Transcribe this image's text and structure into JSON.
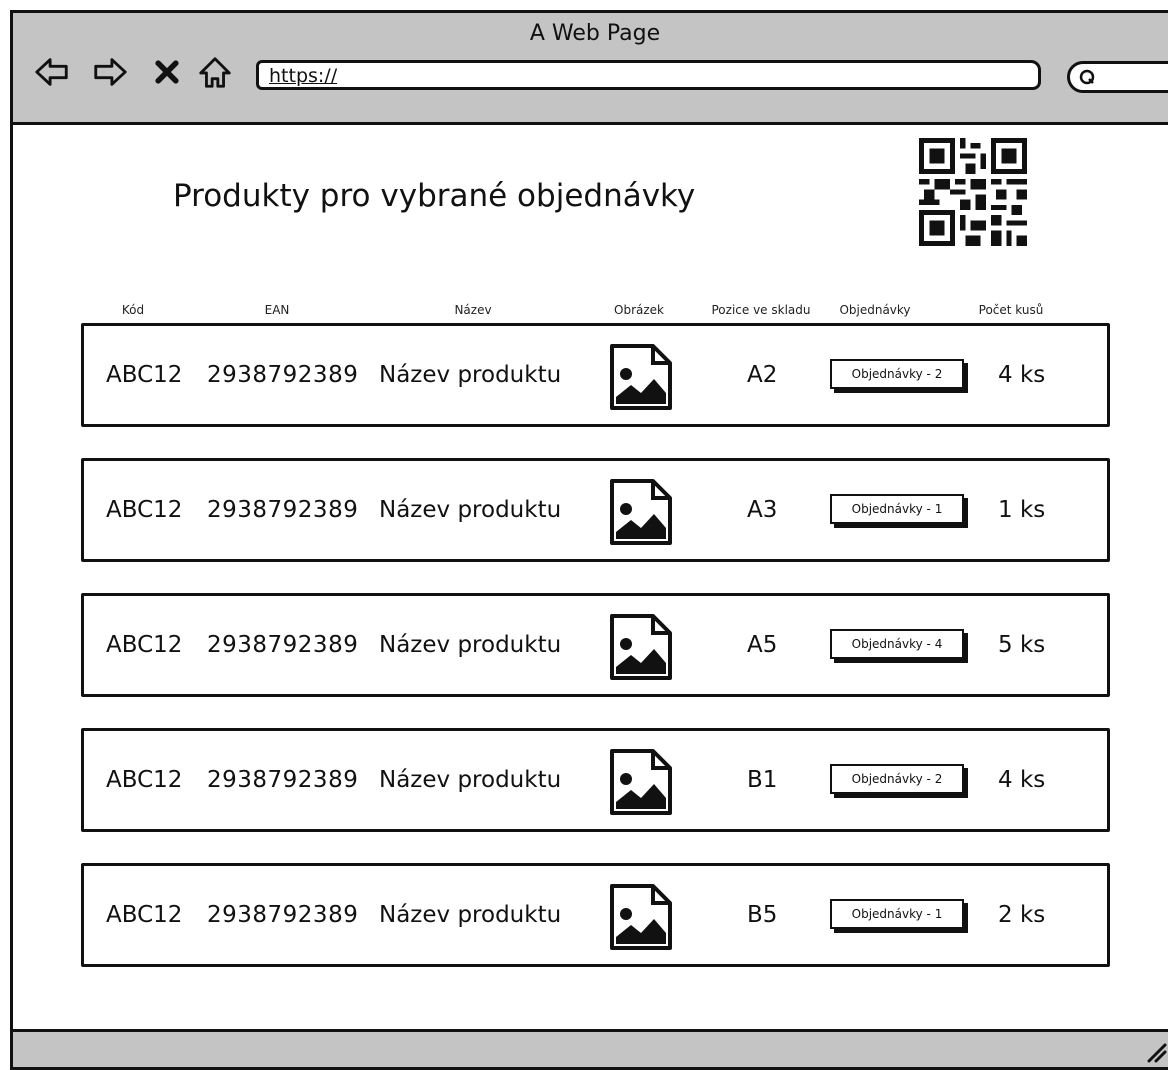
{
  "window": {
    "title": "A Web Page"
  },
  "browser": {
    "url": "https://"
  },
  "page": {
    "title": "Produkty pro vybrané objednávky"
  },
  "table": {
    "headers": {
      "kod": "Kód",
      "ean": "EAN",
      "nazev": "Název",
      "obrazek": "Obrázek",
      "pozice": "Pozice ve skladu",
      "objednavky": "Objednávky",
      "pocet": "Počet kusů"
    },
    "rows": [
      {
        "kod": "ABC12",
        "ean": "2938792389",
        "nazev": "Název produktu",
        "pozice": "A2",
        "objednavky": "Objednávky - 2",
        "pocet": "4 ks"
      },
      {
        "kod": "ABC12",
        "ean": "2938792389",
        "nazev": "Název produktu",
        "pozice": "A3",
        "objednavky": "Objednávky - 1",
        "pocet": "1 ks"
      },
      {
        "kod": "ABC12",
        "ean": "2938792389",
        "nazev": "Název produktu",
        "pozice": "A5",
        "objednavky": "Objednávky - 4",
        "pocet": "5 ks"
      },
      {
        "kod": "ABC12",
        "ean": "2938792389",
        "nazev": "Název produktu",
        "pozice": "B1",
        "objednavky": "Objednávky - 2",
        "pocet": "4 ks"
      },
      {
        "kod": "ABC12",
        "ean": "2938792389",
        "nazev": "Název produktu",
        "pozice": "B5",
        "objednavky": "Objednávky - 1",
        "pocet": "2 ks"
      }
    ]
  },
  "icons": {
    "back": "back-arrow-icon",
    "forward": "forward-arrow-icon",
    "stop": "close-icon",
    "home": "home-icon",
    "search": "search-icon",
    "qr": "qr-code-icon",
    "image": "image-placeholder-icon",
    "resize": "resize-grip-icon"
  },
  "colors": {
    "chrome": "#c4c4c4",
    "ink": "#111111",
    "background": "#ffffff"
  }
}
